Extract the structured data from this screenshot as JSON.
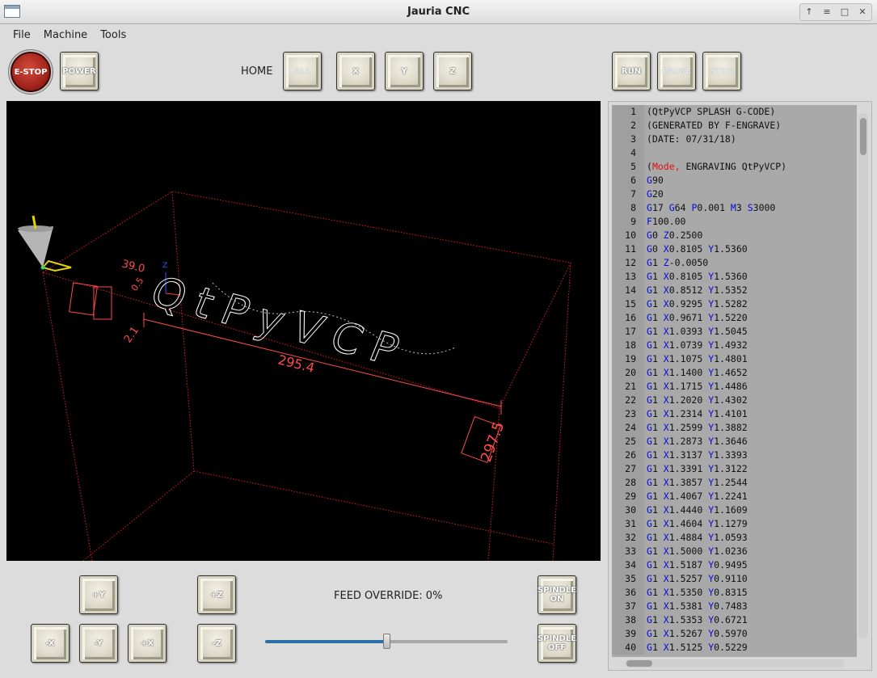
{
  "window": {
    "title": "Jauria CNC",
    "controls": [
      "↑",
      "≡",
      "□",
      "✕"
    ]
  },
  "menu": [
    "File",
    "Machine",
    "Tools"
  ],
  "toolbar": {
    "estop": "E-STOP",
    "power": "POWER",
    "home_label": "HOME",
    "home_all": "ALL",
    "home_x": "X",
    "home_y": "Y",
    "home_z": "Z",
    "run": "RUN",
    "pause": "PAUSE",
    "stop": "STOP"
  },
  "viewport": {
    "program_text": "QtPyVCP",
    "dim_length": "295.4",
    "dim_width": "297.5",
    "dim_small_a": "39.0",
    "dim_small_b": "2.1",
    "dim_small_c": "0.5",
    "axis_z": "Z",
    "colors": {
      "bounds": "#e01b1b",
      "path": "#ffffff",
      "cone": "#b5b5b5",
      "tool_marker": "#e3d400"
    }
  },
  "gcode": {
    "lines": [
      [
        {
          "t": "(QtPyVCP SPLASH G-CODE)"
        }
      ],
      [
        {
          "t": "(GENERATED BY F-ENGRAVE)"
        }
      ],
      [
        {
          "t": "(DATE: 07/31/18)"
        }
      ],
      [
        {
          "t": ""
        }
      ],
      [
        {
          "t": "("
        },
        {
          "t": "Mode,",
          "c": "r"
        },
        {
          "t": " ENGRAVING QtPyVCP)"
        }
      ],
      [
        {
          "t": "G",
          "c": "g"
        },
        {
          "t": "90"
        }
      ],
      [
        {
          "t": "G",
          "c": "g"
        },
        {
          "t": "20"
        }
      ],
      [
        {
          "t": "G",
          "c": "g"
        },
        {
          "t": "17 "
        },
        {
          "t": "G",
          "c": "g"
        },
        {
          "t": "64 "
        },
        {
          "t": "P",
          "c": "g"
        },
        {
          "t": "0.001 "
        },
        {
          "t": "M",
          "c": "g"
        },
        {
          "t": "3 "
        },
        {
          "t": "S",
          "c": "g"
        },
        {
          "t": "3000"
        }
      ],
      [
        {
          "t": "F",
          "c": "g"
        },
        {
          "t": "100.00"
        }
      ],
      [
        {
          "t": "G",
          "c": "g"
        },
        {
          "t": "0 "
        },
        {
          "t": "Z",
          "c": "g"
        },
        {
          "t": "0.2500"
        }
      ],
      [
        {
          "t": "G",
          "c": "g"
        },
        {
          "t": "0 "
        },
        {
          "t": "X",
          "c": "g"
        },
        {
          "t": "0.8105 "
        },
        {
          "t": "Y",
          "c": "g"
        },
        {
          "t": "1.5360"
        }
      ],
      [
        {
          "t": "G",
          "c": "g"
        },
        {
          "t": "1 "
        },
        {
          "t": "Z",
          "c": "g"
        },
        {
          "t": "-0.0050"
        }
      ],
      [
        {
          "t": "G",
          "c": "g"
        },
        {
          "t": "1 "
        },
        {
          "t": "X",
          "c": "g"
        },
        {
          "t": "0.8105 "
        },
        {
          "t": "Y",
          "c": "g"
        },
        {
          "t": "1.5360"
        }
      ],
      [
        {
          "t": "G",
          "c": "g"
        },
        {
          "t": "1 "
        },
        {
          "t": "X",
          "c": "g"
        },
        {
          "t": "0.8512 "
        },
        {
          "t": "Y",
          "c": "g"
        },
        {
          "t": "1.5352"
        }
      ],
      [
        {
          "t": "G",
          "c": "g"
        },
        {
          "t": "1 "
        },
        {
          "t": "X",
          "c": "g"
        },
        {
          "t": "0.9295 "
        },
        {
          "t": "Y",
          "c": "g"
        },
        {
          "t": "1.5282"
        }
      ],
      [
        {
          "t": "G",
          "c": "g"
        },
        {
          "t": "1 "
        },
        {
          "t": "X",
          "c": "g"
        },
        {
          "t": "0.9671 "
        },
        {
          "t": "Y",
          "c": "g"
        },
        {
          "t": "1.5220"
        }
      ],
      [
        {
          "t": "G",
          "c": "g"
        },
        {
          "t": "1 "
        },
        {
          "t": "X",
          "c": "g"
        },
        {
          "t": "1.0393 "
        },
        {
          "t": "Y",
          "c": "g"
        },
        {
          "t": "1.5045"
        }
      ],
      [
        {
          "t": "G",
          "c": "g"
        },
        {
          "t": "1 "
        },
        {
          "t": "X",
          "c": "g"
        },
        {
          "t": "1.0739 "
        },
        {
          "t": "Y",
          "c": "g"
        },
        {
          "t": "1.4932"
        }
      ],
      [
        {
          "t": "G",
          "c": "g"
        },
        {
          "t": "1 "
        },
        {
          "t": "X",
          "c": "g"
        },
        {
          "t": "1.1075 "
        },
        {
          "t": "Y",
          "c": "g"
        },
        {
          "t": "1.4801"
        }
      ],
      [
        {
          "t": "G",
          "c": "g"
        },
        {
          "t": "1 "
        },
        {
          "t": "X",
          "c": "g"
        },
        {
          "t": "1.1400 "
        },
        {
          "t": "Y",
          "c": "g"
        },
        {
          "t": "1.4652"
        }
      ],
      [
        {
          "t": "G",
          "c": "g"
        },
        {
          "t": "1 "
        },
        {
          "t": "X",
          "c": "g"
        },
        {
          "t": "1.1715 "
        },
        {
          "t": "Y",
          "c": "g"
        },
        {
          "t": "1.4486"
        }
      ],
      [
        {
          "t": "G",
          "c": "g"
        },
        {
          "t": "1 "
        },
        {
          "t": "X",
          "c": "g"
        },
        {
          "t": "1.2020 "
        },
        {
          "t": "Y",
          "c": "g"
        },
        {
          "t": "1.4302"
        }
      ],
      [
        {
          "t": "G",
          "c": "g"
        },
        {
          "t": "1 "
        },
        {
          "t": "X",
          "c": "g"
        },
        {
          "t": "1.2314 "
        },
        {
          "t": "Y",
          "c": "g"
        },
        {
          "t": "1.4101"
        }
      ],
      [
        {
          "t": "G",
          "c": "g"
        },
        {
          "t": "1 "
        },
        {
          "t": "X",
          "c": "g"
        },
        {
          "t": "1.2599 "
        },
        {
          "t": "Y",
          "c": "g"
        },
        {
          "t": "1.3882"
        }
      ],
      [
        {
          "t": "G",
          "c": "g"
        },
        {
          "t": "1 "
        },
        {
          "t": "X",
          "c": "g"
        },
        {
          "t": "1.2873 "
        },
        {
          "t": "Y",
          "c": "g"
        },
        {
          "t": "1.3646"
        }
      ],
      [
        {
          "t": "G",
          "c": "g"
        },
        {
          "t": "1 "
        },
        {
          "t": "X",
          "c": "g"
        },
        {
          "t": "1.3137 "
        },
        {
          "t": "Y",
          "c": "g"
        },
        {
          "t": "1.3393"
        }
      ],
      [
        {
          "t": "G",
          "c": "g"
        },
        {
          "t": "1 "
        },
        {
          "t": "X",
          "c": "g"
        },
        {
          "t": "1.3391 "
        },
        {
          "t": "Y",
          "c": "g"
        },
        {
          "t": "1.3122"
        }
      ],
      [
        {
          "t": "G",
          "c": "g"
        },
        {
          "t": "1 "
        },
        {
          "t": "X",
          "c": "g"
        },
        {
          "t": "1.3857 "
        },
        {
          "t": "Y",
          "c": "g"
        },
        {
          "t": "1.2544"
        }
      ],
      [
        {
          "t": "G",
          "c": "g"
        },
        {
          "t": "1 "
        },
        {
          "t": "X",
          "c": "g"
        },
        {
          "t": "1.4067 "
        },
        {
          "t": "Y",
          "c": "g"
        },
        {
          "t": "1.2241"
        }
      ],
      [
        {
          "t": "G",
          "c": "g"
        },
        {
          "t": "1 "
        },
        {
          "t": "X",
          "c": "g"
        },
        {
          "t": "1.4440 "
        },
        {
          "t": "Y",
          "c": "g"
        },
        {
          "t": "1.1609"
        }
      ],
      [
        {
          "t": "G",
          "c": "g"
        },
        {
          "t": "1 "
        },
        {
          "t": "X",
          "c": "g"
        },
        {
          "t": "1.4604 "
        },
        {
          "t": "Y",
          "c": "g"
        },
        {
          "t": "1.1279"
        }
      ],
      [
        {
          "t": "G",
          "c": "g"
        },
        {
          "t": "1 "
        },
        {
          "t": "X",
          "c": "g"
        },
        {
          "t": "1.4884 "
        },
        {
          "t": "Y",
          "c": "g"
        },
        {
          "t": "1.0593"
        }
      ],
      [
        {
          "t": "G",
          "c": "g"
        },
        {
          "t": "1 "
        },
        {
          "t": "X",
          "c": "g"
        },
        {
          "t": "1.5000 "
        },
        {
          "t": "Y",
          "c": "g"
        },
        {
          "t": "1.0236"
        }
      ],
      [
        {
          "t": "G",
          "c": "g"
        },
        {
          "t": "1 "
        },
        {
          "t": "X",
          "c": "g"
        },
        {
          "t": "1.5187 "
        },
        {
          "t": "Y",
          "c": "g"
        },
        {
          "t": "0.9495"
        }
      ],
      [
        {
          "t": "G",
          "c": "g"
        },
        {
          "t": "1 "
        },
        {
          "t": "X",
          "c": "g"
        },
        {
          "t": "1.5257 "
        },
        {
          "t": "Y",
          "c": "g"
        },
        {
          "t": "0.9110"
        }
      ],
      [
        {
          "t": "G",
          "c": "g"
        },
        {
          "t": "1 "
        },
        {
          "t": "X",
          "c": "g"
        },
        {
          "t": "1.5350 "
        },
        {
          "t": "Y",
          "c": "g"
        },
        {
          "t": "0.8315"
        }
      ],
      [
        {
          "t": "G",
          "c": "g"
        },
        {
          "t": "1 "
        },
        {
          "t": "X",
          "c": "g"
        },
        {
          "t": "1.5381 "
        },
        {
          "t": "Y",
          "c": "g"
        },
        {
          "t": "0.7483"
        }
      ],
      [
        {
          "t": "G",
          "c": "g"
        },
        {
          "t": "1 "
        },
        {
          "t": "X",
          "c": "g"
        },
        {
          "t": "1.5353 "
        },
        {
          "t": "Y",
          "c": "g"
        },
        {
          "t": "0.6721"
        }
      ],
      [
        {
          "t": "G",
          "c": "g"
        },
        {
          "t": "1 "
        },
        {
          "t": "X",
          "c": "g"
        },
        {
          "t": "1.5267 "
        },
        {
          "t": "Y",
          "c": "g"
        },
        {
          "t": "0.5970"
        }
      ],
      [
        {
          "t": "G",
          "c": "g"
        },
        {
          "t": "1 "
        },
        {
          "t": "X",
          "c": "g"
        },
        {
          "t": "1.5125 "
        },
        {
          "t": "Y",
          "c": "g"
        },
        {
          "t": "0.5229"
        }
      ]
    ]
  },
  "jog": {
    "plus_y": "+Y",
    "plus_z": "+Z",
    "minus_x": "-X",
    "minus_y": "-Y",
    "plus_x": "+X",
    "minus_z": "-Z"
  },
  "feed": {
    "label": "FEED OVERRIDE: 0%",
    "slider_fraction": 0.5
  },
  "spindle": {
    "on": "SPINDLE ON",
    "off": "SPINDLE OFF"
  }
}
